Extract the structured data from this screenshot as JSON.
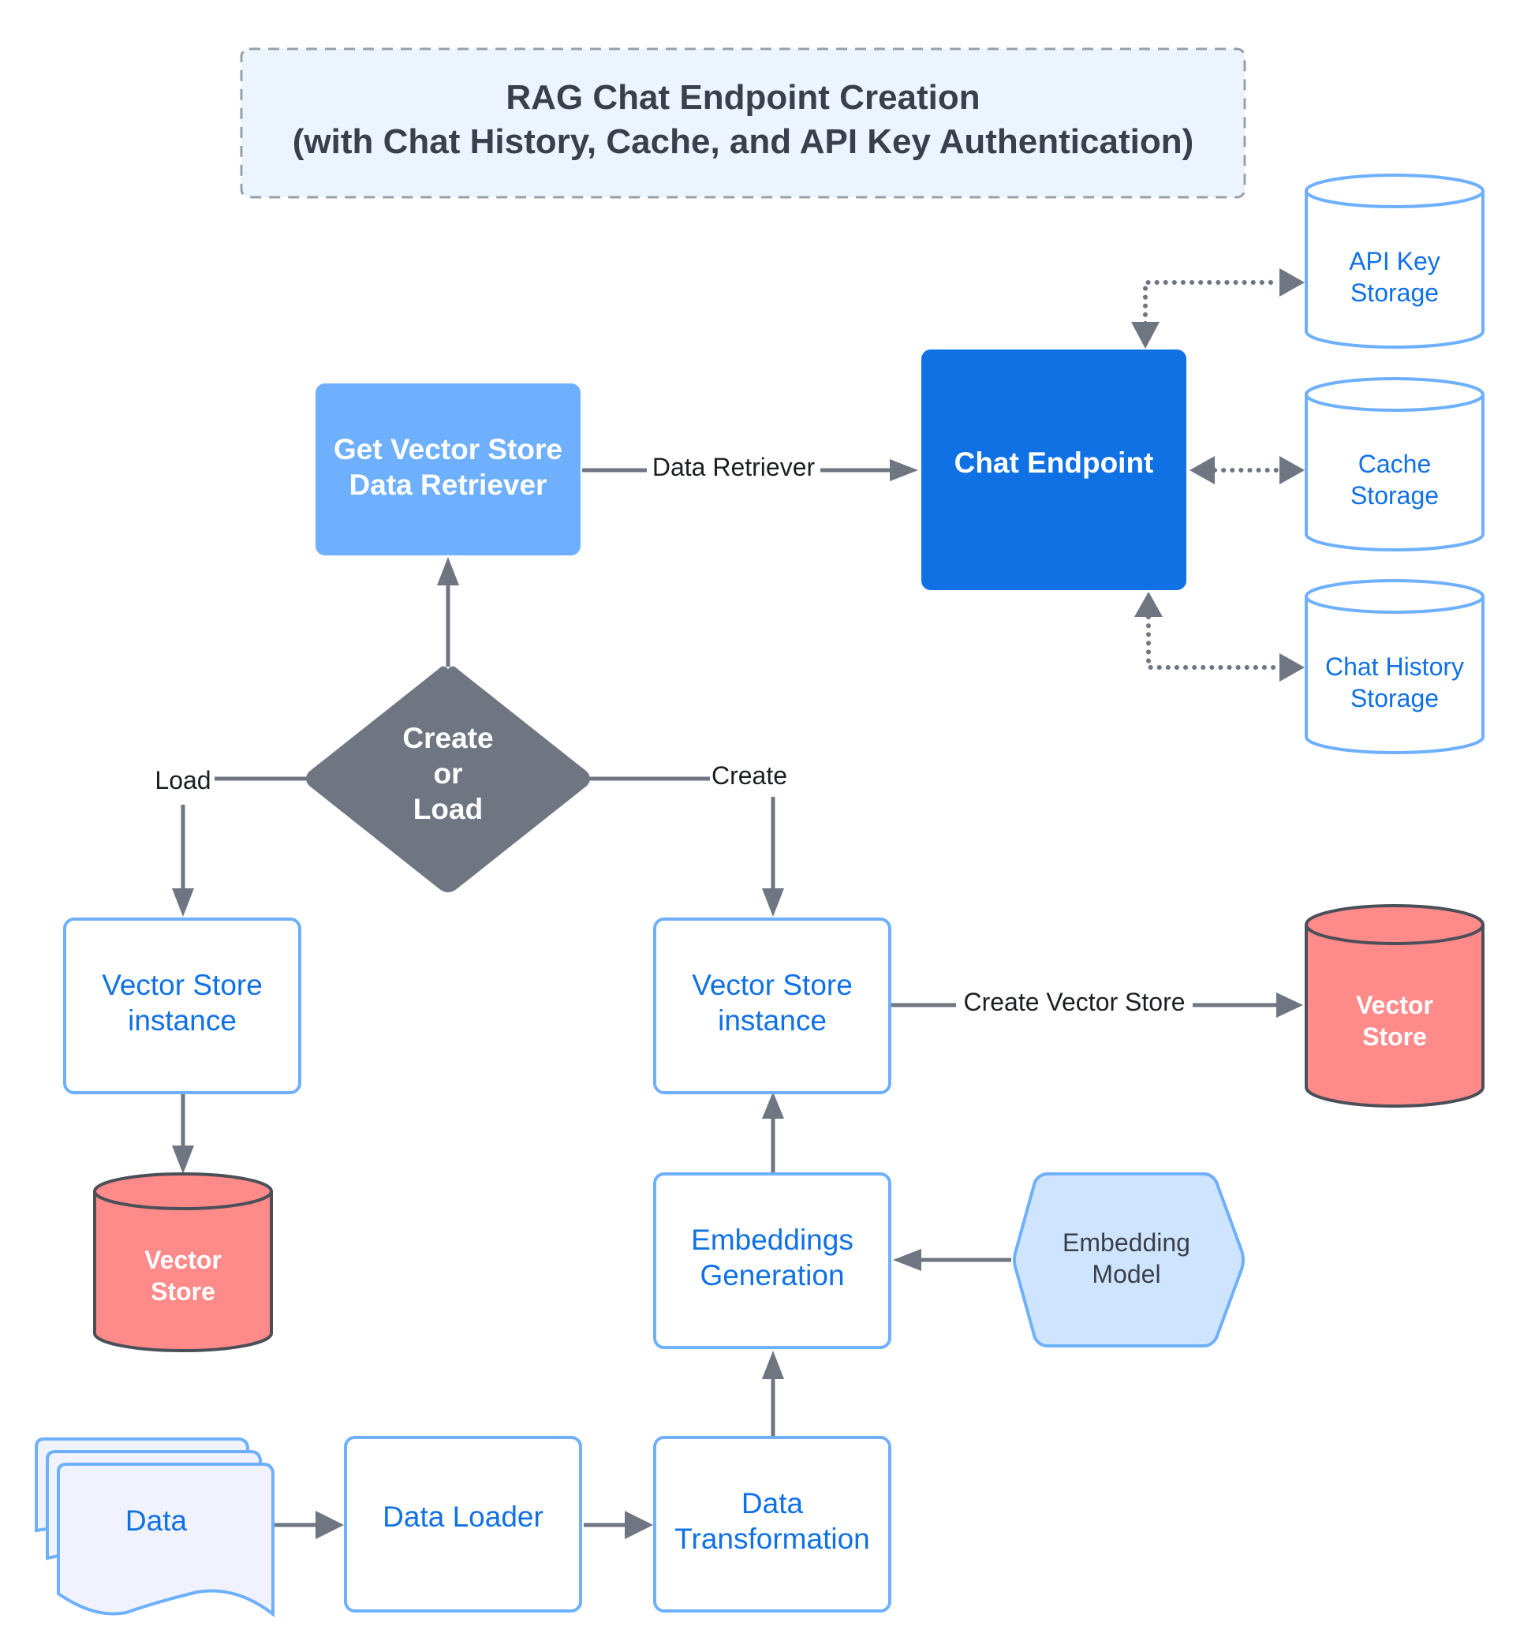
{
  "title": {
    "line1": "RAG Chat Endpoint Creation",
    "line2": "(with Chat History, Cache, and API Key Authentication)"
  },
  "colors": {
    "title_bg": "#ebf4ff",
    "title_border": "#9aa0aa",
    "primary_blue": "#1071e5",
    "light_blue": "#6eb0fd",
    "outline_blue": "#6eb0fd",
    "decision_gray": "#6f7581",
    "arrow_gray": "#6f7581",
    "vector_store_red": "#ff8a8a",
    "embedding_model_fill": "#cfe4ff",
    "data_doc_fill": "#f0f2fd"
  },
  "nodes": {
    "retriever": {
      "line1": "Get Vector Store",
      "line2": "Data Retriever"
    },
    "chat_endpoint": {
      "label": "Chat Endpoint"
    },
    "api_key_storage": {
      "line1": "API Key",
      "line2": "Storage"
    },
    "cache_storage": {
      "line1": "Cache",
      "line2": "Storage"
    },
    "chat_history_storage": {
      "line1": "Chat History",
      "line2": "Storage"
    },
    "decision": {
      "line1": "Create",
      "line2": "or",
      "line3": "Load"
    },
    "vs_instance_load": {
      "line1": "Vector Store",
      "line2": "instance"
    },
    "vs_instance_create": {
      "line1": "Vector Store",
      "line2": "instance"
    },
    "vector_store_load": {
      "line1": "Vector",
      "line2": "Store"
    },
    "vector_store_create": {
      "line1": "Vector",
      "line2": "Store"
    },
    "embeddings_generation": {
      "line1": "Embeddings",
      "line2": "Generation"
    },
    "embedding_model": {
      "line1": "Embedding",
      "line2": "Model"
    },
    "data": {
      "label": "Data"
    },
    "data_loader": {
      "label": "Data Loader"
    },
    "data_transformation": {
      "line1": "Data",
      "line2": "Transformation"
    }
  },
  "edges": {
    "data_retriever": "Data Retriever",
    "load": "Load",
    "create": "Create",
    "create_vector_store": "Create Vector Store"
  }
}
